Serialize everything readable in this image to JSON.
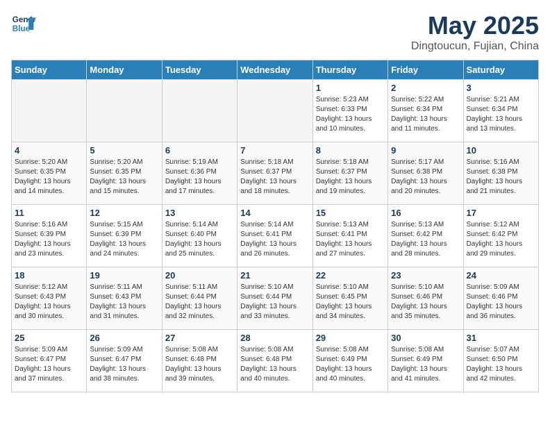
{
  "header": {
    "logo_line1": "General",
    "logo_line2": "Blue",
    "title": "May 2025",
    "subtitle": "Dingtoucun, Fujian, China"
  },
  "weekdays": [
    "Sunday",
    "Monday",
    "Tuesday",
    "Wednesday",
    "Thursday",
    "Friday",
    "Saturday"
  ],
  "weeks": [
    [
      {
        "day": "",
        "info": ""
      },
      {
        "day": "",
        "info": ""
      },
      {
        "day": "",
        "info": ""
      },
      {
        "day": "",
        "info": ""
      },
      {
        "day": "1",
        "info": "Sunrise: 5:23 AM\nSunset: 6:33 PM\nDaylight: 13 hours\nand 10 minutes."
      },
      {
        "day": "2",
        "info": "Sunrise: 5:22 AM\nSunset: 6:34 PM\nDaylight: 13 hours\nand 11 minutes."
      },
      {
        "day": "3",
        "info": "Sunrise: 5:21 AM\nSunset: 6:34 PM\nDaylight: 13 hours\nand 13 minutes."
      }
    ],
    [
      {
        "day": "4",
        "info": "Sunrise: 5:20 AM\nSunset: 6:35 PM\nDaylight: 13 hours\nand 14 minutes."
      },
      {
        "day": "5",
        "info": "Sunrise: 5:20 AM\nSunset: 6:35 PM\nDaylight: 13 hours\nand 15 minutes."
      },
      {
        "day": "6",
        "info": "Sunrise: 5:19 AM\nSunset: 6:36 PM\nDaylight: 13 hours\nand 17 minutes."
      },
      {
        "day": "7",
        "info": "Sunrise: 5:18 AM\nSunset: 6:37 PM\nDaylight: 13 hours\nand 18 minutes."
      },
      {
        "day": "8",
        "info": "Sunrise: 5:18 AM\nSunset: 6:37 PM\nDaylight: 13 hours\nand 19 minutes."
      },
      {
        "day": "9",
        "info": "Sunrise: 5:17 AM\nSunset: 6:38 PM\nDaylight: 13 hours\nand 20 minutes."
      },
      {
        "day": "10",
        "info": "Sunrise: 5:16 AM\nSunset: 6:38 PM\nDaylight: 13 hours\nand 21 minutes."
      }
    ],
    [
      {
        "day": "11",
        "info": "Sunrise: 5:16 AM\nSunset: 6:39 PM\nDaylight: 13 hours\nand 23 minutes."
      },
      {
        "day": "12",
        "info": "Sunrise: 5:15 AM\nSunset: 6:39 PM\nDaylight: 13 hours\nand 24 minutes."
      },
      {
        "day": "13",
        "info": "Sunrise: 5:14 AM\nSunset: 6:40 PM\nDaylight: 13 hours\nand 25 minutes."
      },
      {
        "day": "14",
        "info": "Sunrise: 5:14 AM\nSunset: 6:41 PM\nDaylight: 13 hours\nand 26 minutes."
      },
      {
        "day": "15",
        "info": "Sunrise: 5:13 AM\nSunset: 6:41 PM\nDaylight: 13 hours\nand 27 minutes."
      },
      {
        "day": "16",
        "info": "Sunrise: 5:13 AM\nSunset: 6:42 PM\nDaylight: 13 hours\nand 28 minutes."
      },
      {
        "day": "17",
        "info": "Sunrise: 5:12 AM\nSunset: 6:42 PM\nDaylight: 13 hours\nand 29 minutes."
      }
    ],
    [
      {
        "day": "18",
        "info": "Sunrise: 5:12 AM\nSunset: 6:43 PM\nDaylight: 13 hours\nand 30 minutes."
      },
      {
        "day": "19",
        "info": "Sunrise: 5:11 AM\nSunset: 6:43 PM\nDaylight: 13 hours\nand 31 minutes."
      },
      {
        "day": "20",
        "info": "Sunrise: 5:11 AM\nSunset: 6:44 PM\nDaylight: 13 hours\nand 32 minutes."
      },
      {
        "day": "21",
        "info": "Sunrise: 5:10 AM\nSunset: 6:44 PM\nDaylight: 13 hours\nand 33 minutes."
      },
      {
        "day": "22",
        "info": "Sunrise: 5:10 AM\nSunset: 6:45 PM\nDaylight: 13 hours\nand 34 minutes."
      },
      {
        "day": "23",
        "info": "Sunrise: 5:10 AM\nSunset: 6:46 PM\nDaylight: 13 hours\nand 35 minutes."
      },
      {
        "day": "24",
        "info": "Sunrise: 5:09 AM\nSunset: 6:46 PM\nDaylight: 13 hours\nand 36 minutes."
      }
    ],
    [
      {
        "day": "25",
        "info": "Sunrise: 5:09 AM\nSunset: 6:47 PM\nDaylight: 13 hours\nand 37 minutes."
      },
      {
        "day": "26",
        "info": "Sunrise: 5:09 AM\nSunset: 6:47 PM\nDaylight: 13 hours\nand 38 minutes."
      },
      {
        "day": "27",
        "info": "Sunrise: 5:08 AM\nSunset: 6:48 PM\nDaylight: 13 hours\nand 39 minutes."
      },
      {
        "day": "28",
        "info": "Sunrise: 5:08 AM\nSunset: 6:48 PM\nDaylight: 13 hours\nand 40 minutes."
      },
      {
        "day": "29",
        "info": "Sunrise: 5:08 AM\nSunset: 6:49 PM\nDaylight: 13 hours\nand 40 minutes."
      },
      {
        "day": "30",
        "info": "Sunrise: 5:08 AM\nSunset: 6:49 PM\nDaylight: 13 hours\nand 41 minutes."
      },
      {
        "day": "31",
        "info": "Sunrise: 5:07 AM\nSunset: 6:50 PM\nDaylight: 13 hours\nand 42 minutes."
      }
    ]
  ]
}
